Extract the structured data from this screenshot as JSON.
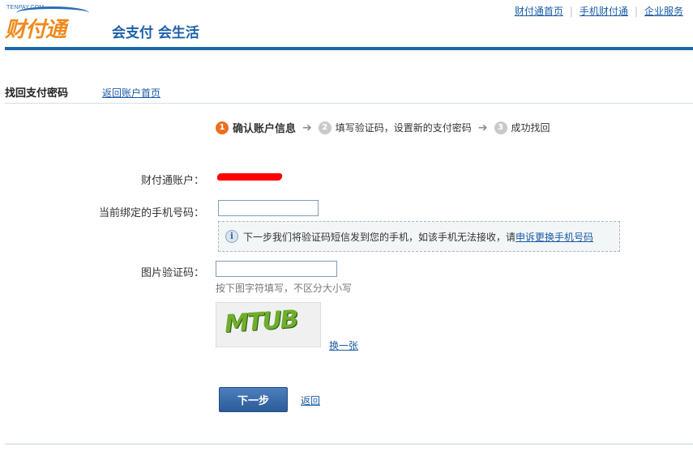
{
  "brand": {
    "logo_small": "TENPAY.COM",
    "logo_main": "财付通",
    "slogan": "会支付 会生活"
  },
  "top_nav": {
    "items": [
      "财付通首页",
      "手机财付通",
      "企业服务"
    ],
    "separator": "|"
  },
  "subheader": {
    "title": "找回支付密码",
    "back_link": "返回账户首页"
  },
  "steps": [
    {
      "num": "1",
      "label": "确认账户信息",
      "active": true
    },
    {
      "num": "2",
      "label": "填写验证码，设置新的支付密码",
      "active": false
    },
    {
      "num": "3",
      "label": "成功找回",
      "active": false
    }
  ],
  "form": {
    "account_label": "财付通账户：",
    "phone_label": "当前绑定的手机号码：",
    "phone_value": "",
    "info_text": "下一步我们将验证码短信发到您的手机，如该手机无法接收，请",
    "info_link": "申诉更换手机号码",
    "captcha_label": "图片验证码：",
    "captcha_value": "",
    "captcha_hint": "按下图字符填写，不区分大小写",
    "captcha_image_text": "MTUB",
    "refresh_link": "换一张",
    "next_button": "下一步",
    "back_link": "返回"
  },
  "colors": {
    "brand_blue": "#1b69a8",
    "brand_orange": "#f08a1c",
    "step_active": "#e8701e",
    "redaction": "#ff0000"
  }
}
